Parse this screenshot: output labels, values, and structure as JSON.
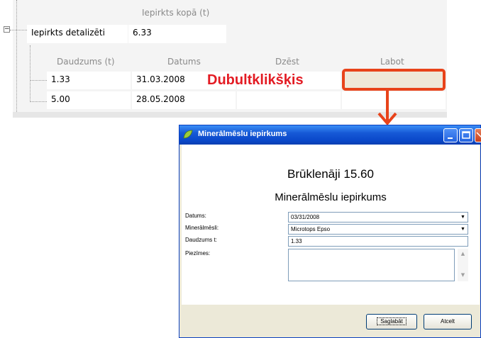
{
  "grid": {
    "header_total": "Iepirkts kopā (t)",
    "parent_label": "Iepirkts detalizēti",
    "parent_value": "6.33",
    "columns": [
      "Daudzums (t)",
      "Datums",
      "Dzēst",
      "Labot"
    ],
    "rows": [
      {
        "qty": "1.33",
        "date": "31.03.2008",
        "delete": "",
        "edit": ""
      },
      {
        "qty": "5.00",
        "date": "28.05.2008",
        "delete": "",
        "edit": ""
      }
    ],
    "expander": "−"
  },
  "annotation": {
    "text": "Dubultklikšķis",
    "color": "#e31b23",
    "arrow_color": "#e8431a"
  },
  "dialog": {
    "title": "Minerālmēslu iepirkums",
    "heading": "Brūklenāji 15.60",
    "subheading": "Minerālmēslu iepirkums",
    "fields": {
      "date_label": "Datums:",
      "date_value": "03/31/2008",
      "fertilizer_label": "Minerālmēsli:",
      "fertilizer_value": "Microtops Epso",
      "quantity_label": "Daudzums t:",
      "quantity_value": "1.33",
      "notes_label": "Piezīmes:",
      "notes_value": ""
    },
    "save_label": "Saglabāt",
    "cancel_label": "Atcelt",
    "titlebar_color": "#0a47c9"
  }
}
